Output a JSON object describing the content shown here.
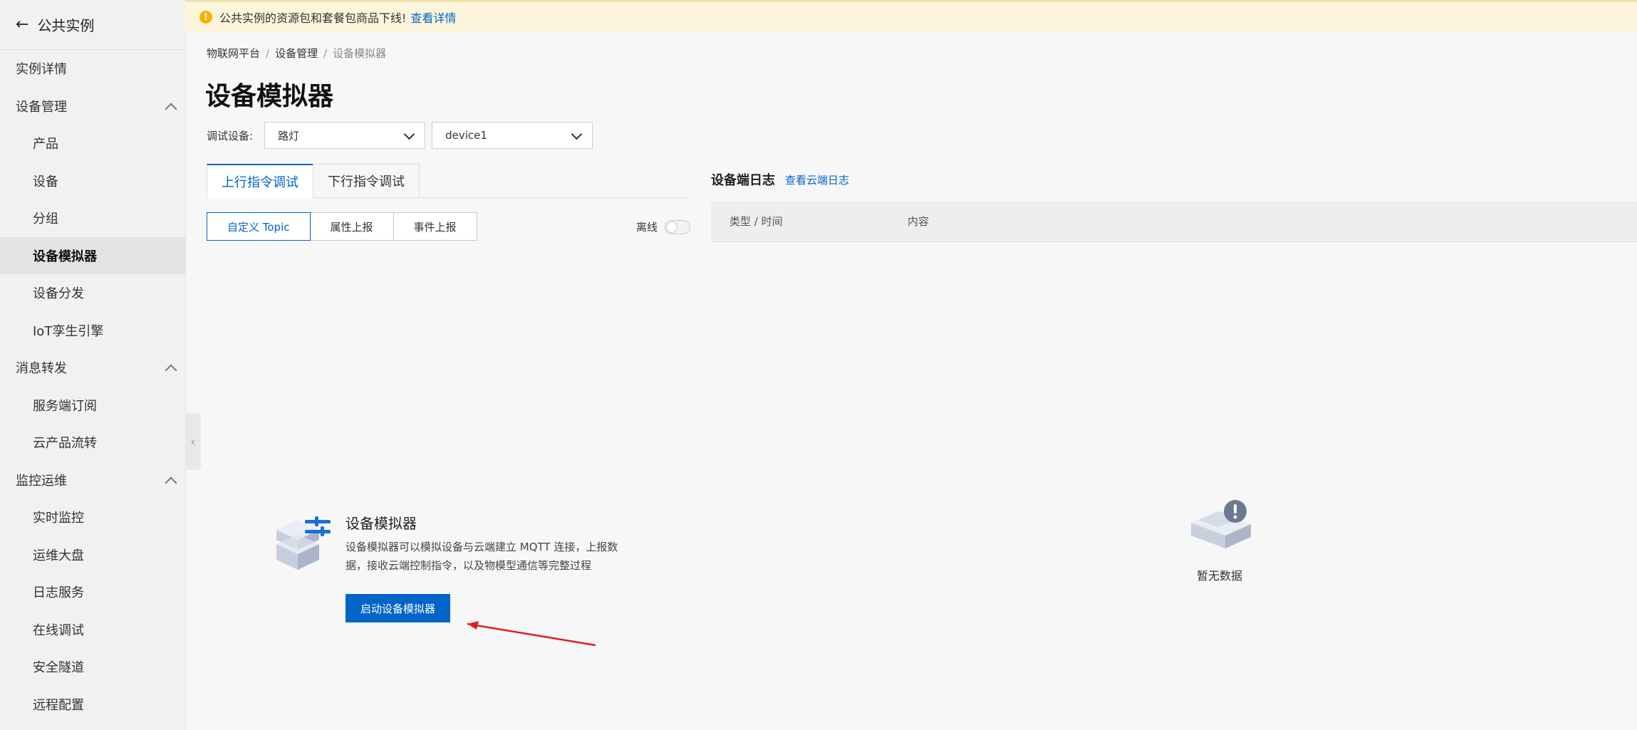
{
  "sidebar": {
    "header": "公共实例",
    "items": [
      {
        "label": "实例详情",
        "level": 1
      },
      {
        "label": "设备管理",
        "level": 1,
        "expandable": true
      },
      {
        "label": "产品",
        "level": 2
      },
      {
        "label": "设备",
        "level": 2
      },
      {
        "label": "分组",
        "level": 2
      },
      {
        "label": "设备模拟器",
        "level": 2,
        "active": true
      },
      {
        "label": "设备分发",
        "level": 2
      },
      {
        "label": "IoT孪生引擎",
        "level": 2
      },
      {
        "label": "消息转发",
        "level": 1,
        "expandable": true
      },
      {
        "label": "服务端订阅",
        "level": 2
      },
      {
        "label": "云产品流转",
        "level": 2
      },
      {
        "label": "监控运维",
        "level": 1,
        "expandable": true
      },
      {
        "label": "实时监控",
        "level": 2
      },
      {
        "label": "运维大盘",
        "level": 2
      },
      {
        "label": "日志服务",
        "level": 2
      },
      {
        "label": "在线调试",
        "level": 2
      },
      {
        "label": "安全隧道",
        "level": 2
      },
      {
        "label": "远程配置",
        "level": 2
      }
    ]
  },
  "notice": {
    "text": "公共实例的资源包和套餐包商品下线!",
    "link": "查看详情"
  },
  "breadcrumb": [
    "物联网平台",
    "设备管理",
    "设备模拟器"
  ],
  "page_title": "设备模拟器",
  "debug_device": {
    "label": "调试设备:",
    "product": "路灯",
    "device": "device1"
  },
  "tabs": [
    "上行指令调试",
    "下行指令调试"
  ],
  "subtabs": [
    "自定义 Topic",
    "属性上报",
    "事件上报"
  ],
  "status": {
    "label": "离线"
  },
  "log": {
    "title": "设备端日志",
    "link": "查看云端日志",
    "col_type": "类型 / 时间",
    "col_content": "内容",
    "empty": "暂无数据"
  },
  "simulator": {
    "title": "设备模拟器",
    "desc": "设备模拟器可以模拟设备与云端建立 MQTT 连接，上报数据，接收云端控制指令，以及物模型通信等完整过程",
    "button": "启动设备模拟器"
  },
  "colors": {
    "accent": "#0064c8",
    "annotation_arrow": "#e31c1c"
  }
}
